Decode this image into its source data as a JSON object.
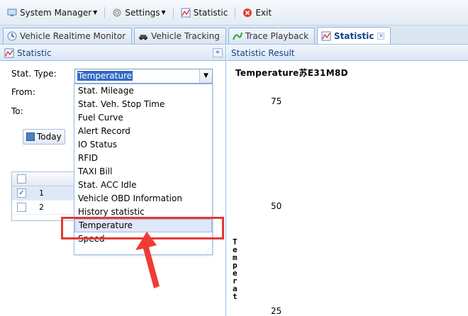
{
  "menu": {
    "items": [
      {
        "label": "System Manager",
        "icon": "monitor-icon",
        "has_arrow": true
      },
      {
        "label": "Settings",
        "icon": "gear-icon",
        "has_arrow": true
      },
      {
        "label": "Statistic",
        "icon": "chart-icon",
        "has_arrow": false
      },
      {
        "label": "Exit",
        "icon": "exit-icon",
        "has_arrow": false
      }
    ]
  },
  "tabs": [
    {
      "label": "Vehicle Realtime Monitor",
      "icon": "clock-icon",
      "active": false
    },
    {
      "label": "Vehicle Tracking",
      "icon": "car-icon",
      "active": false
    },
    {
      "label": "Trace Playback",
      "icon": "trace-icon",
      "active": false
    },
    {
      "label": "Statistic",
      "icon": "chart-icon",
      "active": true
    }
  ],
  "left_panel": {
    "title": "Statistic",
    "collapse_glyph": "«",
    "stat_type_label": "Stat. Type:",
    "stat_type_value": "Temperature",
    "from_label": "From:",
    "to_label": "To:",
    "today_button": "Today",
    "grid_rows": [
      "1",
      "2"
    ]
  },
  "dropdown": {
    "options": [
      "Stat. Mileage",
      "Stat. Veh. Stop Time",
      "Fuel Curve",
      "Alert Record",
      "IO Status",
      "RFID",
      "TAXI Bill",
      "Stat. ACC Idle",
      "Vehicle OBD Information",
      "History statistic",
      "Temperature",
      "Speed"
    ],
    "highlighted": "Temperature"
  },
  "right_panel": {
    "title": "Statistic Result",
    "chart_title": "Temperature苏E31M8D",
    "y_axis_label": "Temperat",
    "ticks": [
      "75",
      "50",
      "25"
    ]
  },
  "chart_data": {
    "type": "line",
    "title": "Temperature苏E31M8D",
    "ylabel": "Temperat",
    "yticks": [
      75,
      50,
      25
    ],
    "series": []
  },
  "colors": {
    "accent": "#15428b",
    "highlight": "#e53935",
    "selection": "#316ac5"
  }
}
